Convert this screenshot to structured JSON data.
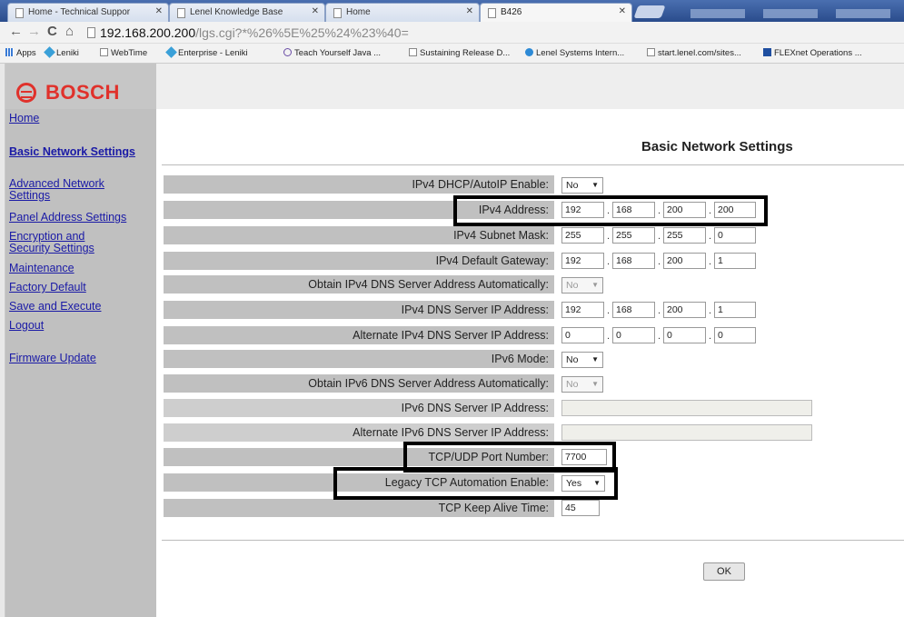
{
  "browser": {
    "tabs": [
      {
        "label": "Home - Technical Suppor"
      },
      {
        "label": "Lenel Knowledge Base"
      },
      {
        "label": "Home"
      },
      {
        "label": "B426"
      }
    ],
    "url_host": "192.168.200.200",
    "url_path": "/lgs.cgi?*%26%5E%25%24%23%40=",
    "bookmarks": [
      {
        "label": "Apps"
      },
      {
        "label": "Leniki"
      },
      {
        "label": "WebTime"
      },
      {
        "label": "Enterprise - Leniki"
      },
      {
        "label": "Teach Yourself Java ..."
      },
      {
        "label": "Sustaining Release D..."
      },
      {
        "label": "Lenel Systems Intern..."
      },
      {
        "label": "start.lenel.com/sites..."
      },
      {
        "label": "FLEXnet Operations ..."
      }
    ]
  },
  "brand": {
    "name": "BOSCH",
    "color": "#e0312b"
  },
  "sidebar": {
    "items": [
      {
        "label": "Home"
      },
      {
        "label": "Basic Network Settings"
      },
      {
        "label": "Advanced Network Settings"
      },
      {
        "label": "Panel Address Settings"
      },
      {
        "label": "Encryption and Security Settings"
      },
      {
        "label": "Maintenance"
      },
      {
        "label": "Factory Default"
      },
      {
        "label": "Save and Execute"
      },
      {
        "label": "Logout"
      },
      {
        "label": "Firmware Update"
      }
    ]
  },
  "main": {
    "title": "Basic Network Settings",
    "rows": [
      {
        "label": "IPv4 DHCP/AutoIP Enable:",
        "select": "No"
      },
      {
        "label": "IPv4 Address:",
        "octets": [
          "192",
          "168",
          "200",
          "200"
        ]
      },
      {
        "label": "IPv4 Subnet Mask:",
        "octets": [
          "255",
          "255",
          "255",
          "0"
        ]
      },
      {
        "label": "IPv4 Default Gateway:",
        "octets": [
          "192",
          "168",
          "200",
          "1"
        ]
      },
      {
        "label": "Obtain IPv4 DNS Server Address Automatically:",
        "select": "No"
      },
      {
        "label": "IPv4 DNS Server IP Address:",
        "octets": [
          "192",
          "168",
          "200",
          "1"
        ]
      },
      {
        "label": "Alternate IPv4 DNS Server IP Address:",
        "octets": [
          "0",
          "0",
          "0",
          "0"
        ]
      },
      {
        "label": "IPv6 Mode:",
        "select": "No"
      },
      {
        "label": "Obtain IPv6 DNS Server Address Automatically:",
        "select": "No"
      },
      {
        "label": "IPv6 DNS Server IP Address:",
        "value": ""
      },
      {
        "label": "Alternate IPv6 DNS Server IP Address:",
        "value": ""
      },
      {
        "label": "TCP/UDP Port Number:",
        "value": "7700"
      },
      {
        "label": "Legacy TCP Automation Enable:",
        "select": "Yes"
      },
      {
        "label": "TCP Keep Alive Time:",
        "value": "45"
      }
    ],
    "ok_label": "OK"
  }
}
